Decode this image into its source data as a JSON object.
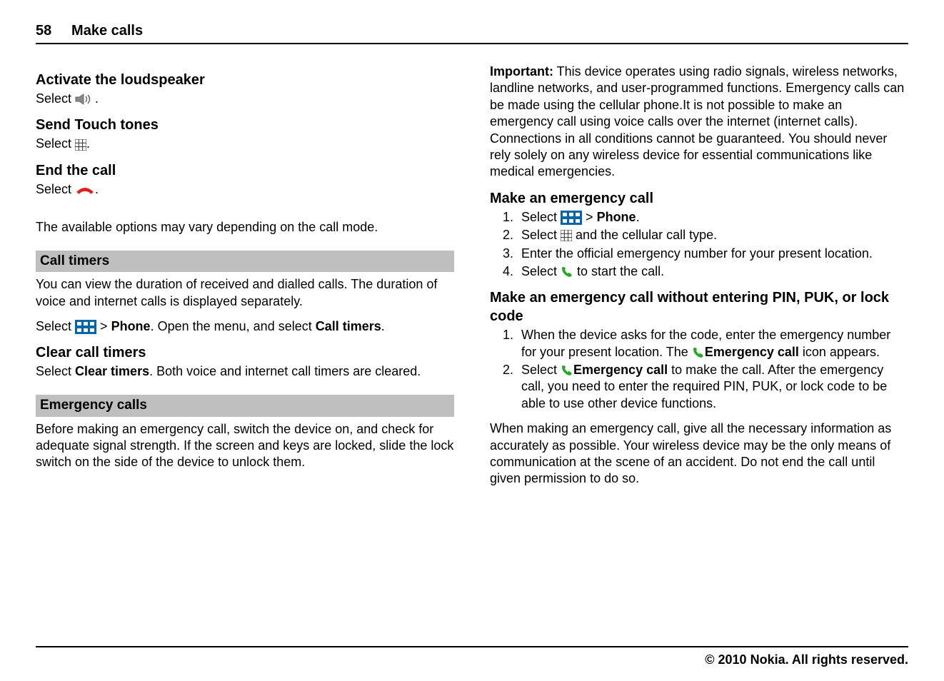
{
  "header": {
    "page_number": "58",
    "section_title": "Make calls"
  },
  "left": {
    "loudspeaker": {
      "title": "Activate the loudspeaker",
      "select": "Select ",
      "period": "."
    },
    "touchtones": {
      "title": "Send Touch tones",
      "select": "Select ",
      "period": "."
    },
    "endcall": {
      "title": "End the call",
      "select": "Select ",
      "period": "."
    },
    "modes_note": "The available options may vary depending on the call mode.",
    "call_timers": {
      "bar": "Call timers",
      "intro": "You can view the duration of received and dialled calls. The duration of voice and internet calls is displayed separately.",
      "select_prefix": "Select ",
      "gt": " > ",
      "phone_label": "Phone",
      "after_phone": ". Open the menu, and select ",
      "call_timers_label": "Call timers",
      "period": "."
    },
    "clear_timers": {
      "title": "Clear call timers",
      "select_prefix": "Select ",
      "clear_label": "Clear timers",
      "rest": ". Both voice and internet call timers are cleared."
    },
    "emergency": {
      "bar": "Emergency calls",
      "intro": "Before making an emergency call, switch the device on, and check for adequate signal strength. If the screen and keys are locked, slide the lock switch on the side of the device to unlock them."
    }
  },
  "right": {
    "important": {
      "label": "Important:",
      "text": "  This device operates using radio signals, wireless networks, landline networks, and user-programmed functions. Emergency calls can be made using the cellular phone.It is not possible to make an emergency call using voice calls over the internet (internet calls). Connections in all conditions cannot be guaranteed. You should never rely solely on any wireless device for essential communications like medical emergencies."
    },
    "make_call": {
      "title": "Make an emergency call",
      "step1_a": "Select ",
      "step1_gt": " > ",
      "step1_phone": "Phone",
      "step1_period": ".",
      "step2_a": "Select ",
      "step2_b": " and the cellular call type.",
      "step3": "Enter the official emergency number for your present location.",
      "step4_a": "Select ",
      "step4_b": " to start the call."
    },
    "no_code": {
      "title": "Make an emergency call without entering PIN, PUK, or lock code",
      "step1_a": "When the device asks for the code, enter the emergency number for your present location. The ",
      "step1_label": "Emergency call",
      "step1_b": " icon appears.",
      "step2_a": "Select ",
      "step2_label": "Emergency call",
      "step2_b": " to make the call. After the emergency call, you need to enter the required PIN, PUK, or lock code to be able to use other device functions."
    },
    "final_note": "When making an emergency call, give all the necessary information as accurately as possible. Your wireless device may be the only means of communication at the scene of an accident. Do not end the call until given permission to do so."
  },
  "footer": "© 2010 Nokia. All rights reserved."
}
